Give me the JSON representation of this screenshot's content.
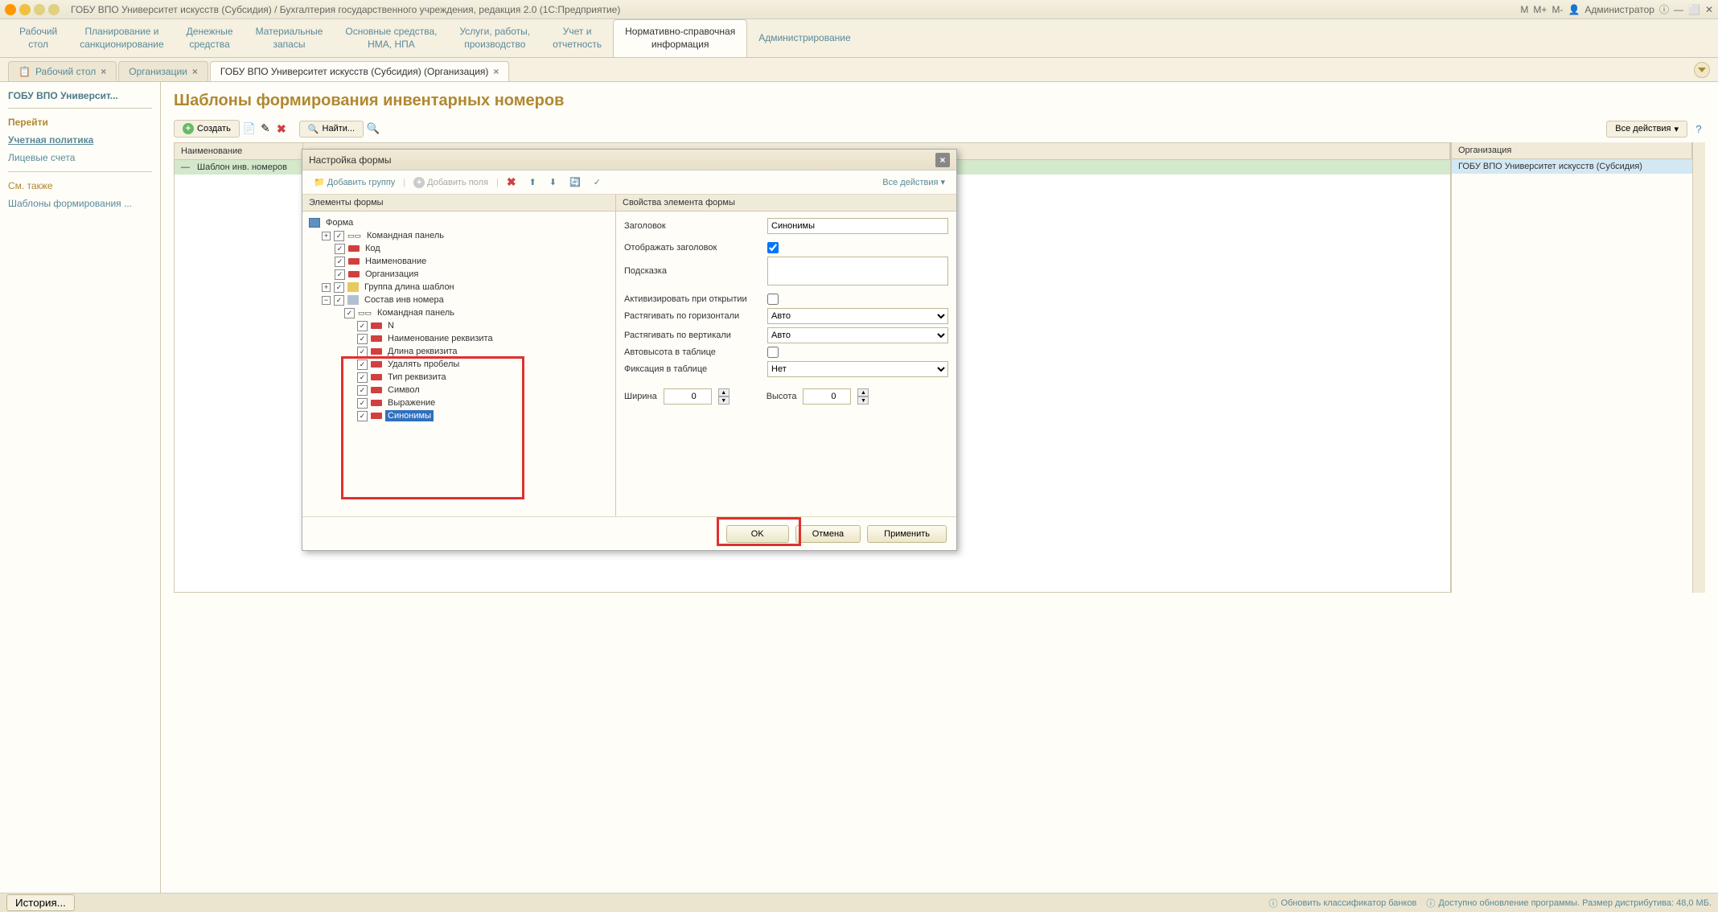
{
  "titlebar": {
    "title": "ГОБУ ВПО Университет искусств (Субсидия) / Бухгалтерия государственного учреждения, редакция 2.0  (1С:Предприятие)",
    "user": "Администратор",
    "m": "M",
    "mplus": "M+",
    "mminus": "M-"
  },
  "mainmenu": {
    "items": [
      "Рабочий\nстол",
      "Планирование и\nсанкционирование",
      "Денежные\nсредства",
      "Материальные\nзапасы",
      "Основные средства,\nНМА, НПА",
      "Услуги, работы,\nпроизводство",
      "Учет и\nотчетность",
      "Нормативно-справочная\nинформация",
      "Администрирование"
    ]
  },
  "tabs": {
    "t1": "Рабочий стол",
    "t2": "Организации",
    "t3": "ГОБУ ВПО Университет искусств (Субсидия) (Организация)"
  },
  "sidebar": {
    "title": "ГОБУ ВПО Университ...",
    "perejti": "Перейти",
    "uchet": "Учетная политика",
    "licevye": "Лицевые счета",
    "smtakzhe": "См. также",
    "shablony": "Шаблоны формирования ..."
  },
  "page": {
    "title": "Шаблоны формирования инвентарных номеров",
    "create": "Создать",
    "find": "Найти...",
    "all_actions": "Все действия",
    "col_name": "Наименование",
    "col_org": "Организация",
    "row1_name": "Шаблон инв. номеров",
    "row1_org": "ГОБУ ВПО Университет искусств (Субсидия)"
  },
  "dialog": {
    "title": "Настройка формы",
    "add_group": "Добавить группу",
    "add_fields": "Добавить поля",
    "all_actions": "Все действия",
    "left_header": "Элементы формы",
    "right_header": "Свойства элемента формы",
    "tree": {
      "form": "Форма",
      "cmdpanel": "Командная панель",
      "kod": "Код",
      "naim": "Наименование",
      "org": "Организация",
      "grp_dlina": "Группа длина шаблон",
      "sostav": "Состав инв номера",
      "cmdpanel2": "Командная панель",
      "n": "N",
      "naim_rek": "Наименование реквизита",
      "dlina_rek": "Длина реквизита",
      "udal": "Удалять пробелы",
      "tip_rek": "Тип реквизита",
      "simvol": "Символ",
      "vyraz": "Выражение",
      "sinonimy": "Синонимы"
    },
    "props": {
      "zagolovok": "Заголовок",
      "zagolovok_val": "Синонимы",
      "otobr": "Отображать заголовок",
      "podskazka": "Подсказка",
      "aktiv": "Активизировать при открытии",
      "rast_h": "Растягивать по горизонтали",
      "rast_v": "Растягивать по вертикали",
      "auto": "Авто",
      "avtovys": "Автовысота в таблице",
      "fiks": "Фиксация в таблице",
      "net": "Нет",
      "shirina": "Ширина",
      "vysota": "Высота",
      "zero": "0"
    },
    "btn_ok": "OK",
    "btn_cancel": "Отмена",
    "btn_apply": "Применить"
  },
  "statusbar": {
    "history": "История...",
    "banks": "Обновить классификатор банков",
    "update": "Доступно обновление программы. Размер дистрибутива: 48,0 МБ."
  }
}
